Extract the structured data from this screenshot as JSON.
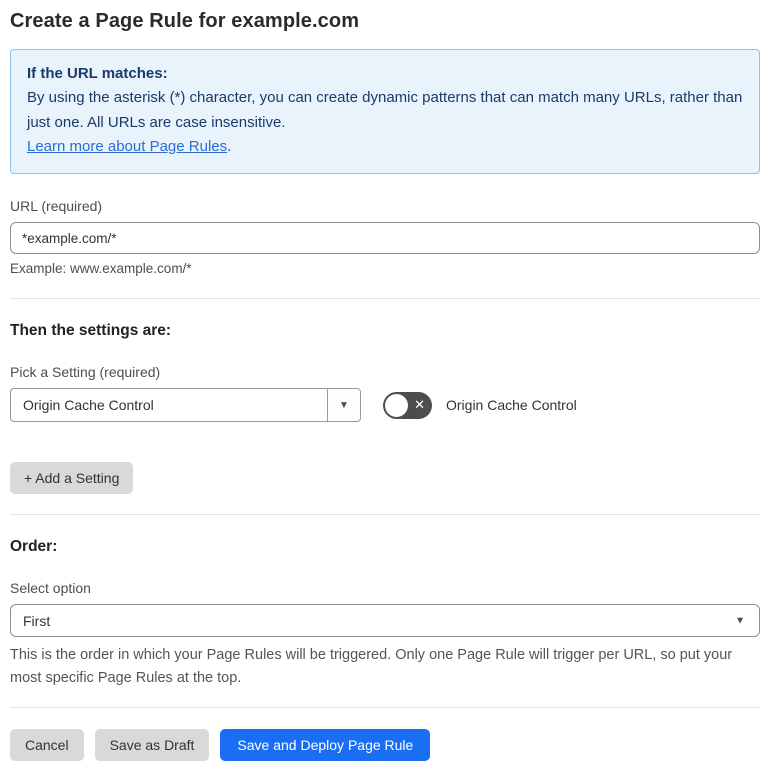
{
  "page": {
    "title": "Create a Page Rule for example.com"
  },
  "info_box": {
    "heading": "If the URL matches:",
    "body": "By using the asterisk (*) character, you can create dynamic patterns that can match many URLs, rather than just one. All URLs are case insensitive.",
    "link_label": "Learn more about Page Rules",
    "link_suffix": "."
  },
  "url_field": {
    "label": "URL (required)",
    "value": "*example.com/*",
    "helper": "Example: www.example.com/*"
  },
  "settings_section": {
    "heading": "Then the settings are:",
    "pick_label": "Pick a Setting (required)",
    "selected_setting": "Origin Cache Control",
    "toggle_state": "off",
    "toggle_label": "Origin Cache Control",
    "add_setting_label": "+ Add a Setting"
  },
  "order_section": {
    "heading": "Order:",
    "select_label": "Select option",
    "selected_option": "First",
    "helper": "This is the order in which your Page Rules will be triggered. Only one Page Rule will trigger per URL, so put your most specific Page Rules at the top."
  },
  "footer": {
    "cancel_label": "Cancel",
    "save_draft_label": "Save as Draft",
    "save_deploy_label": "Save and Deploy Page Rule"
  },
  "icons": {
    "dropdown_caret": "▼",
    "toggle_off_x": "✕"
  },
  "colors": {
    "primary_blue": "#1a6ef3",
    "info_background": "#e8f3fc",
    "info_border": "#8fc3ee",
    "info_text": "#1b3a6b",
    "link_blue": "#2b6cd4",
    "toggle_off_background": "#4d4d4d",
    "button_gray": "#d9d9d9"
  }
}
